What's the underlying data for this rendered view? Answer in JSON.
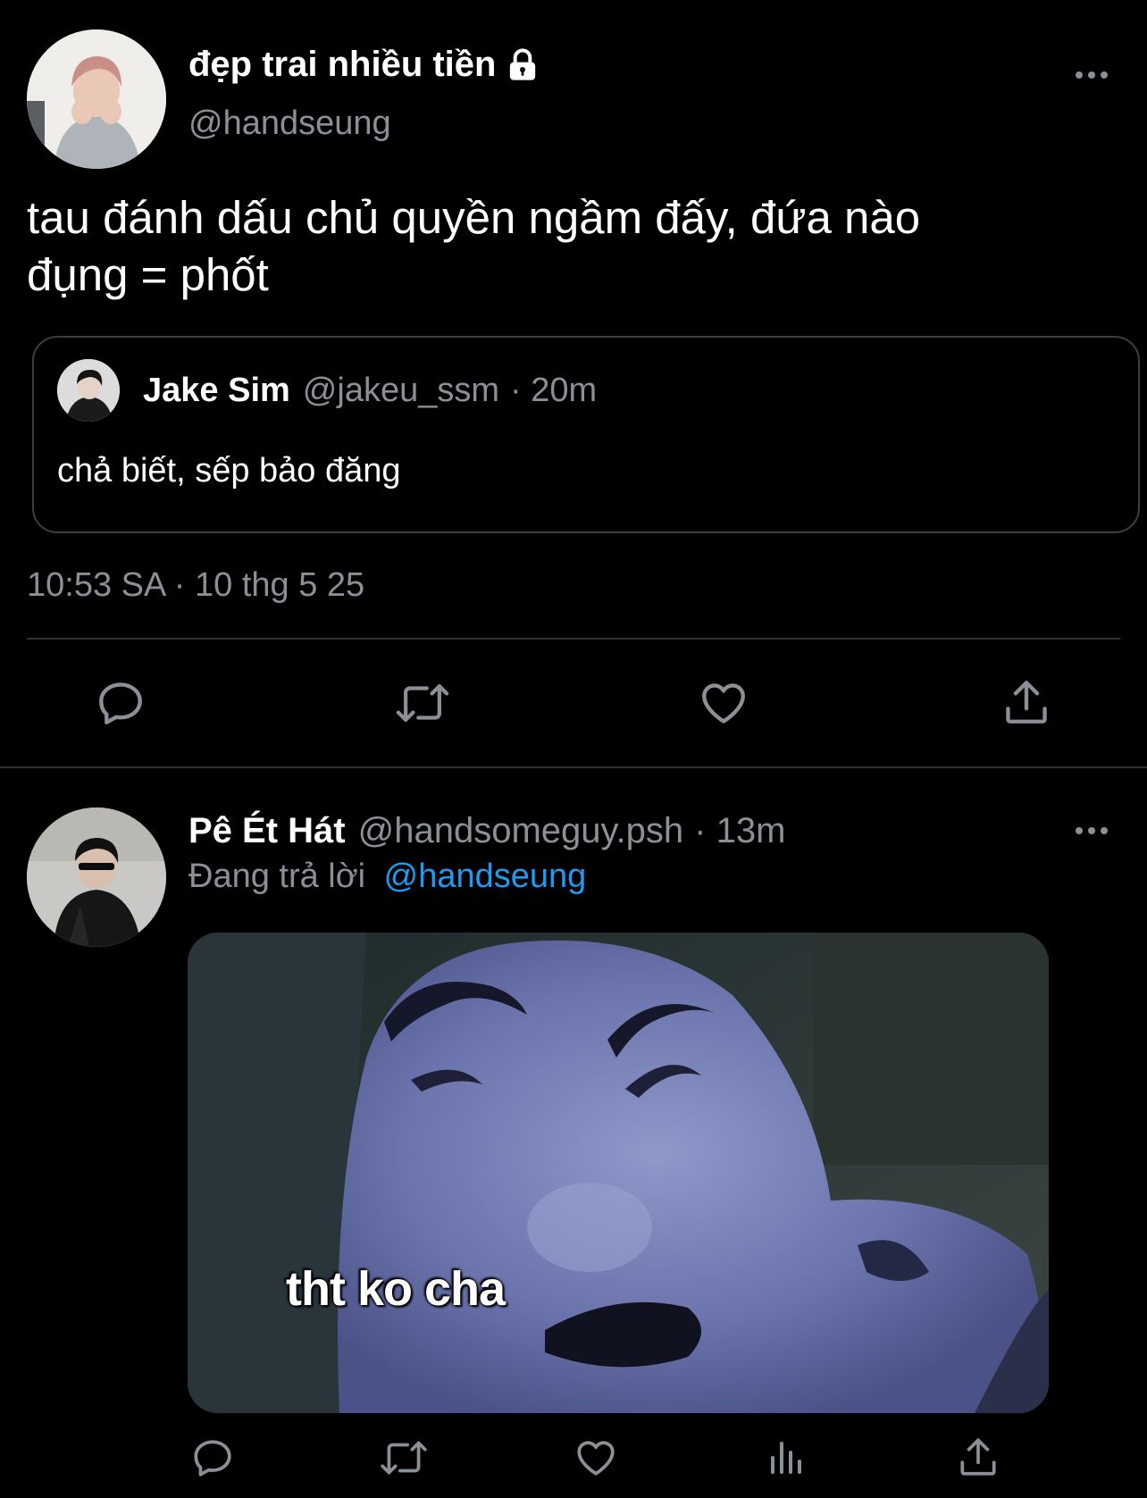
{
  "main_tweet": {
    "display_name": "đẹp trai nhiều tiền",
    "handle": "@handseung",
    "text_line1": "tau đánh dấu chủ quyền ngầm đấy, đứa nào",
    "text_line2": "đụng = phốt",
    "quote": {
      "display_name": "Jake Sim",
      "handle": "@jakeu_ssm",
      "time": "· 20m",
      "text": "chả biết, sếp bảo đăng"
    },
    "timestamp": "10:53 SA · 10 thg 5 25"
  },
  "reply": {
    "display_name": "Pê Ét Hát",
    "handle": "@handsomeguy.psh",
    "time": "· 13m",
    "replying_prefix": "Đang trả lời",
    "replying_to": "@handseung",
    "image_caption": "tht ko cha"
  },
  "colors": {
    "background": "#000000",
    "text": "#e7e9ea",
    "muted": "#71767b",
    "link": "#1d9bf0",
    "divider": "#2f3336"
  },
  "icons": [
    "lock-icon",
    "more-icon",
    "reply-icon",
    "retweet-icon",
    "like-icon",
    "share-icon",
    "analytics-icon"
  ]
}
